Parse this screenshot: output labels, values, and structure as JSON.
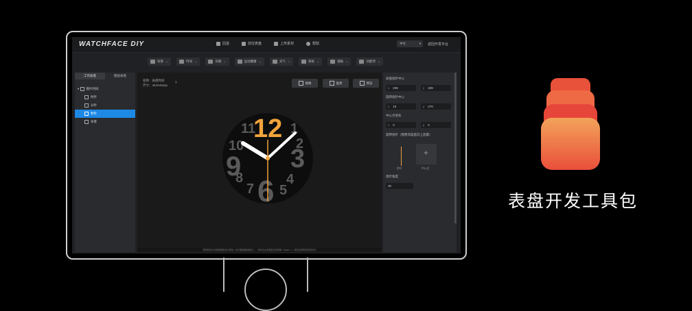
{
  "topbar": {
    "logo": "WATCHFACE DIY",
    "nav": [
      "回退",
      "前往表盘",
      "上传素材",
      "帮助"
    ],
    "language": "中文",
    "back_label": "返回开发平台"
  },
  "toolbar": {
    "items": [
      "背景",
      "时间",
      "日期",
      "运动健康",
      "天气",
      "系统",
      "辅助",
      "功能项"
    ]
  },
  "left_panel": {
    "tabs": [
      "工作表盘",
      "图层表盘"
    ],
    "tree": [
      "图片时间",
      "时针",
      "分针",
      "秒针",
      "背景"
    ],
    "selected_index": 3
  },
  "canvas": {
    "name_line": "名称：表盘时间",
    "size_line": "尺寸：454X454px",
    "buttons": [
      "替换",
      "复原",
      "预览"
    ],
    "footer": "表盘的设计请参照表盘设计规范（请勿直接使用图片），详情请点击表盘文档说明（https://...）我们会帮助您完成设计"
  },
  "right_panel": {
    "rotate_center_label": "表盘指针中心",
    "rotate_x": "208",
    "rotate_y": "208",
    "pivot_label": "旋转指针中心",
    "pivot_x": "16",
    "pivot_y": "276",
    "offset_label": "中心点坐标",
    "offset_x": "0",
    "offset_y": "0",
    "hand_label": "旋转指针（图像须竖直向上放置）",
    "hand_caption": "秒针",
    "center_caption": "中心点",
    "angle_label": "指针角度",
    "angle_value": "30"
  },
  "watch": {
    "numerals": [
      "12",
      "11",
      "10",
      "9",
      "8",
      "7",
      "6",
      "5",
      "4",
      "3",
      "2",
      "1"
    ]
  },
  "promo": {
    "text": "表盘开发工具包"
  },
  "colors": {
    "accent": "#f3a43c",
    "selection": "#1e88e5",
    "icon_top": "#f28a4f",
    "icon_bottom": "#ea4f3a"
  }
}
